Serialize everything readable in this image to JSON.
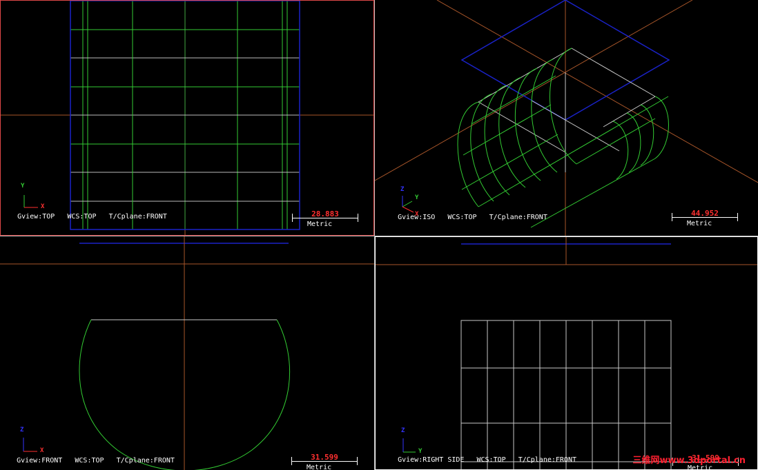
{
  "colors": {
    "grid_green": "#33cc33",
    "plane_blue": "#1a22c8",
    "axis_brown": "#a8562a",
    "wire_white": "#c9c9c9",
    "active_border": "#e04848",
    "scale_red": "#ff3030"
  },
  "viewports": {
    "top": {
      "gview": "Gview:TOP",
      "wcs": "WCS:TOP",
      "cplane": "T/Cplane:FRONT",
      "scale_value": "28.883",
      "scale_unit": "Metric",
      "axes": {
        "a": "Y",
        "b": "X"
      }
    },
    "iso": {
      "gview": "Gview:ISO",
      "wcs": "WCS:TOP",
      "cplane": "T/Cplane:FRONT",
      "scale_value": "44.952",
      "scale_unit": "Metric",
      "axes": {
        "a": "Z",
        "b": "Y",
        "c": "X"
      }
    },
    "front": {
      "gview": "Gview:FRONT",
      "wcs": "WCS:TOP",
      "cplane": "T/Cplane:FRONT",
      "scale_value": "31.599",
      "scale_unit": "Metric",
      "axes": {
        "a": "Z",
        "b": "X"
      }
    },
    "right": {
      "gview": "Gview:RIGHT SIDE",
      "wcs": "WCS:TOP",
      "cplane": "T/Cplane:FRONT",
      "scale_value": "31.599",
      "scale_unit": "Metric",
      "axes": {
        "a": "Z",
        "b": "Y"
      }
    }
  },
  "watermark": "三维网www.3dportal.cn"
}
